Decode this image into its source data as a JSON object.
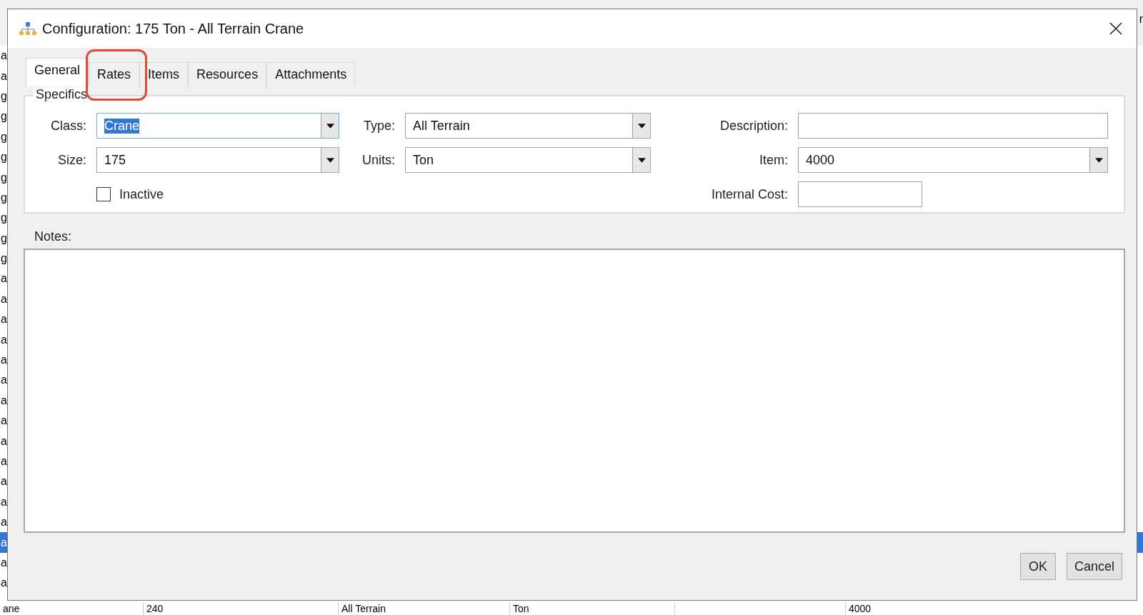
{
  "background": {
    "corner_text": "r",
    "rows": [
      {
        "text": "a",
        "selected": false
      },
      {
        "text": "a",
        "selected": false
      },
      {
        "text": "g",
        "selected": false
      },
      {
        "text": "g",
        "selected": false
      },
      {
        "text": "g",
        "selected": false
      },
      {
        "text": "g",
        "selected": false
      },
      {
        "text": "g",
        "selected": false
      },
      {
        "text": "g",
        "selected": false
      },
      {
        "text": "g",
        "selected": false
      },
      {
        "text": "g",
        "selected": false
      },
      {
        "text": "g",
        "selected": false
      },
      {
        "text": "a",
        "selected": false
      },
      {
        "text": "a",
        "selected": false
      },
      {
        "text": "a",
        "selected": false
      },
      {
        "text": "a",
        "selected": false
      },
      {
        "text": "a",
        "selected": false
      },
      {
        "text": "a",
        "selected": false
      },
      {
        "text": "a",
        "selected": false
      },
      {
        "text": "a",
        "selected": false
      },
      {
        "text": "a",
        "selected": false
      },
      {
        "text": "a",
        "selected": false
      },
      {
        "text": "a",
        "selected": false
      },
      {
        "text": "a",
        "selected": false
      },
      {
        "text": "a",
        "selected": false
      },
      {
        "text": "a",
        "selected": true
      },
      {
        "text": "a",
        "selected": false
      },
      {
        "text": "a",
        "selected": false
      }
    ],
    "last_row": [
      "ane",
      "240",
      "All Terrain",
      "Ton",
      "4000"
    ]
  },
  "window": {
    "title": "Configuration: 175 Ton - All Terrain Crane"
  },
  "tabs": [
    {
      "label": "General",
      "selected": true
    },
    {
      "label": "Rates",
      "selected": false
    },
    {
      "label": "Items",
      "selected": false
    },
    {
      "label": "Resources",
      "selected": false
    },
    {
      "label": "Attachments",
      "selected": false
    }
  ],
  "specifics": {
    "title": "Specifics",
    "columns": [
      [
        {
          "kind": "combo",
          "label": "Class:",
          "value": "Crane",
          "focused": true
        },
        {
          "kind": "combo",
          "label": "Size:",
          "value": "175",
          "focused": false
        },
        {
          "kind": "checkbox",
          "label": "Inactive",
          "checked": false
        }
      ],
      [
        {
          "kind": "combo",
          "label": "Type:",
          "value": "All Terrain",
          "focused": false
        },
        {
          "kind": "combo",
          "label": "Units:",
          "value": "Ton",
          "focused": false
        }
      ],
      [
        {
          "kind": "text",
          "label": "Description:",
          "focused": false
        },
        {
          "kind": "combo",
          "label": "Item:",
          "value": "4000",
          "focused": false
        },
        {
          "kind": "short_text",
          "label": "Internal Cost:",
          "focused": false
        }
      ]
    ]
  },
  "notes": {
    "label": "Notes:"
  },
  "buttons": [
    "OK",
    "Cancel"
  ]
}
